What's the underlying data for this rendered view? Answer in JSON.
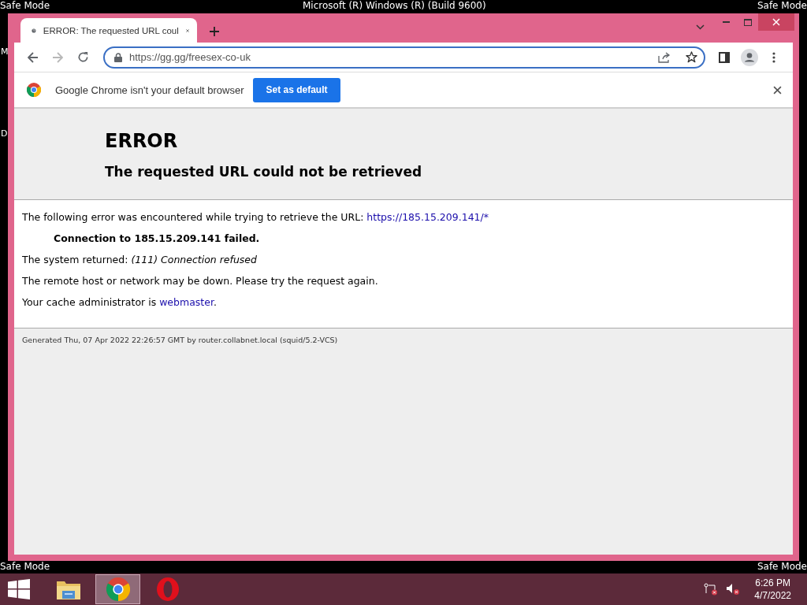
{
  "desktop": {
    "top_left": "Safe Mode",
    "top_center": "Microsoft (R) Windows (R) (Build 9600)",
    "top_right": "Safe Mode",
    "bottom_left": "Safe Mode",
    "bottom_right": "Safe Mode",
    "icon_labels": [
      "M",
      "D"
    ]
  },
  "browser": {
    "tabs": [
      {
        "title": "ERROR: The requested URL coul",
        "selected": true
      }
    ],
    "nav": {
      "back_disabled": false,
      "forward_disabled": true
    },
    "address": "https://gg.gg/freesex-co-uk",
    "infobar": {
      "message": "Google Chrome isn't your default browser",
      "button": "Set as default"
    }
  },
  "page": {
    "title": "ERROR",
    "subtitle": "The requested URL could not be retrieved",
    "intro": "The following error was encountered while trying to retrieve the URL: ",
    "intro_link": "https://185.15.209.141/*",
    "failure": "Connection to 185.15.209.141 failed.",
    "system": "The system returned: *(111) Connection refused*",
    "remote": "The remote host or network may be down. Please try the request again.",
    "admin": "Your cache administrator is ",
    "admin_link": "webmaster",
    "admin_end": ".",
    "footer": "Generated Thu, 07 Apr 2022 22:26:57 GMT by router.collabnet.local (squid/5.2-VCS)"
  },
  "taskbar": {
    "apps": [
      {
        "kind": "explorer",
        "selected": false
      },
      {
        "kind": "chrome",
        "selected": true
      },
      {
        "kind": "opera",
        "selected": false
      }
    ],
    "time": "6:26 PM",
    "date": "4/7/2022"
  }
}
